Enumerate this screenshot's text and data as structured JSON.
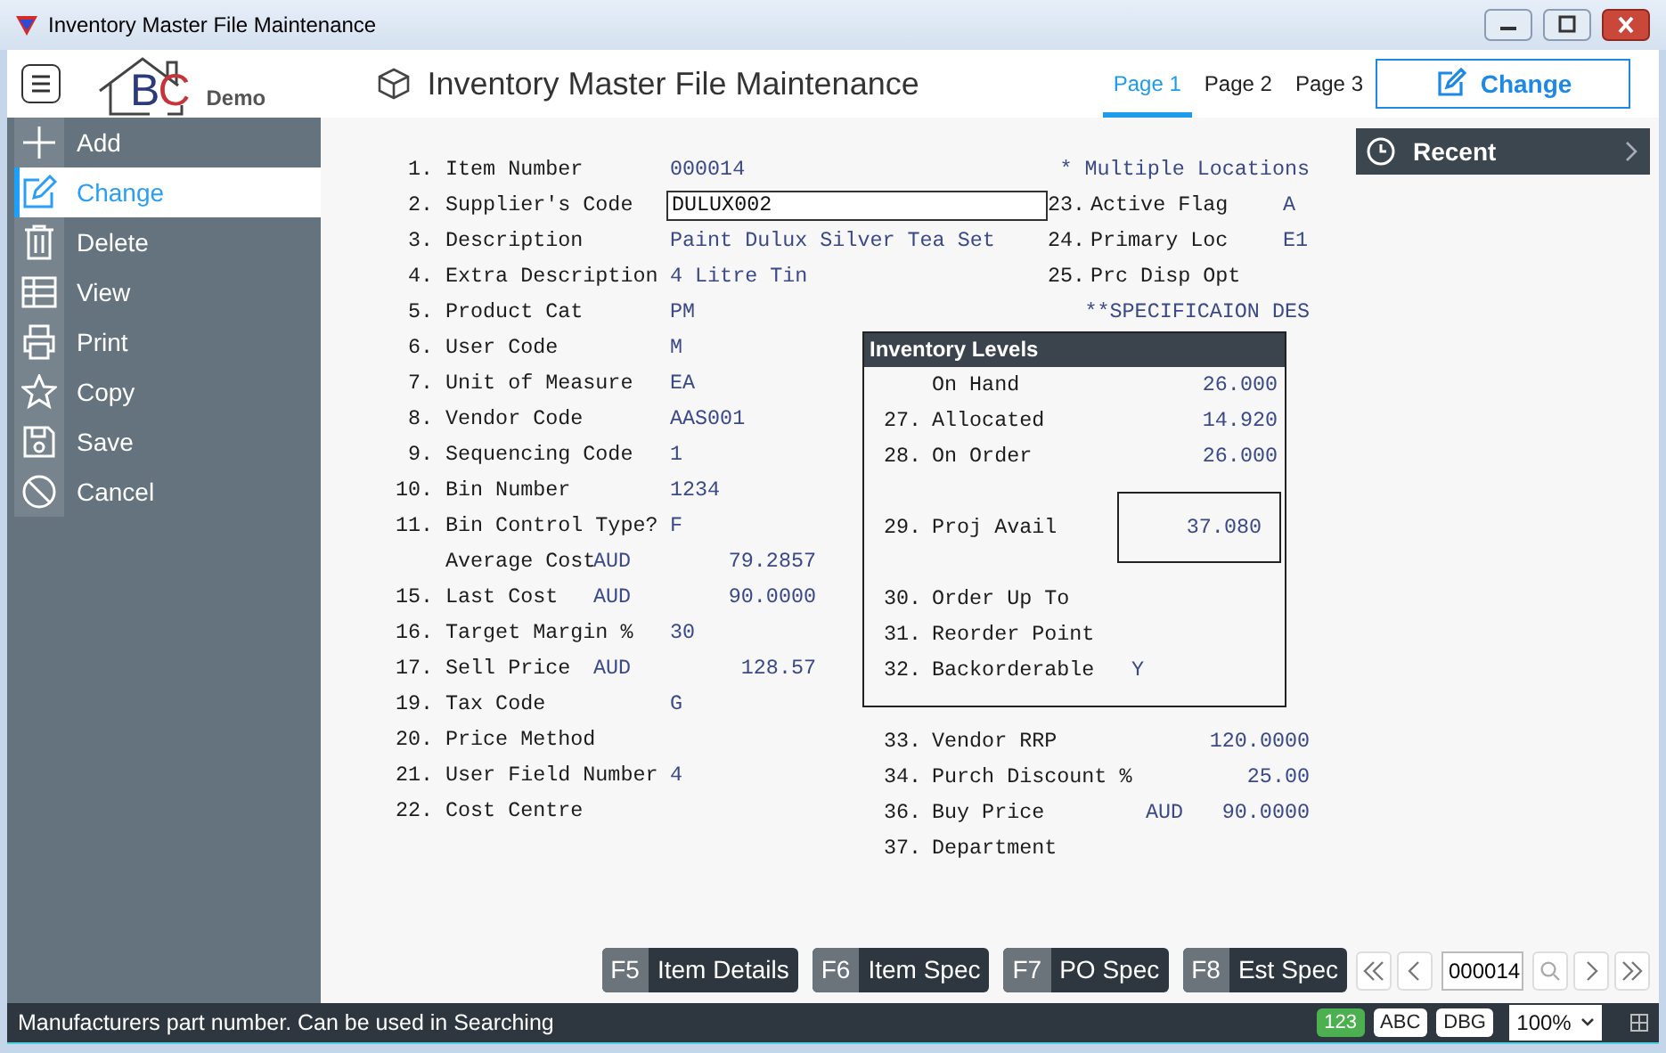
{
  "window": {
    "title": "Inventory Master File Maintenance"
  },
  "header": {
    "logo": {
      "letters": [
        "B",
        "C"
      ],
      "caption": "Demo"
    },
    "title": "Inventory Master File Maintenance",
    "tabs": [
      {
        "label": "Page 1",
        "selected": true
      },
      {
        "label": "Page 2",
        "selected": false
      },
      {
        "label": "Page 3",
        "selected": false
      }
    ],
    "action_button": "Change"
  },
  "sidebar": {
    "items": [
      {
        "label": "Add",
        "selected": false
      },
      {
        "label": "Change",
        "selected": true
      },
      {
        "label": "Delete",
        "selected": false
      },
      {
        "label": "View",
        "selected": false
      },
      {
        "label": "Print",
        "selected": false
      },
      {
        "label": "Copy",
        "selected": false
      },
      {
        "label": "Save",
        "selected": false
      },
      {
        "label": "Cancel",
        "selected": false
      }
    ]
  },
  "form": {
    "top_left": [
      {
        "kind": "text",
        "number": "1.",
        "label": "Item Number",
        "value": "000014"
      },
      {
        "kind": "input",
        "number": "2.",
        "label": "Supplier's Code",
        "value": "DULUX002"
      },
      {
        "kind": "text",
        "number": "3.",
        "label": "Description",
        "value": "Paint Dulux Silver Tea Set"
      },
      {
        "kind": "text",
        "number": "4.",
        "label": "Extra Description",
        "value": "4 Litre Tin"
      },
      {
        "kind": "text",
        "number": "5.",
        "label": "Product Cat",
        "value": "PM"
      }
    ],
    "top_right": [
      {
        "kind": "note",
        "text": "* Multiple Locations"
      },
      {
        "kind": "field",
        "number": "23.",
        "label": "Active Flag",
        "value": "A"
      },
      {
        "kind": "field",
        "number": "24.",
        "label": "Primary Loc",
        "value": "E1"
      },
      {
        "kind": "field",
        "number": "25.",
        "label": "Prc Disp Opt"
      },
      {
        "kind": "note",
        "text": "**SPECIFICAION DES"
      }
    ],
    "left": [
      {
        "number": "6.",
        "label": "User Code",
        "value": "M"
      },
      {
        "number": "7.",
        "label": "Unit of Measure",
        "value": "EA"
      },
      {
        "number": "8.",
        "label": "Vendor Code",
        "value": "AAS001"
      },
      {
        "number": "9.",
        "label": "Sequencing Code",
        "value": "1"
      },
      {
        "number": "10.",
        "label": "Bin Number",
        "value": "1234"
      },
      {
        "number": "11.",
        "label": "Bin Control Type?",
        "value": "F"
      },
      {
        "label": "Average Cost",
        "currency": "AUD",
        "value": "79.2857"
      },
      {
        "number": "15.",
        "label": "Last Cost",
        "currency": "AUD",
        "value": "90.0000"
      },
      {
        "number": "16.",
        "label": "Target Margin %",
        "value": "30"
      },
      {
        "number": "17.",
        "label": "Sell Price",
        "currency": "AUD",
        "value": "128.57"
      },
      {
        "number": "19.",
        "label": "Tax Code",
        "value": "G"
      },
      {
        "number": "20.",
        "label": "Price Method"
      },
      {
        "number": "21.",
        "label": "User Field Number",
        "value": "4"
      },
      {
        "number": "22.",
        "label": "Cost Centre"
      }
    ],
    "levels": {
      "title": "Inventory Levels",
      "rows": [
        {
          "kind": "amount",
          "label": "On Hand",
          "value": "26.000"
        },
        {
          "kind": "amount",
          "number": "27.",
          "label": "Allocated",
          "value": "14.920"
        },
        {
          "kind": "amount",
          "number": "28.",
          "label": "On Order",
          "value": "26.000"
        },
        {
          "kind": "framed",
          "number": "29.",
          "label": "Proj Avail",
          "value": "37.080"
        },
        {
          "kind": "amount",
          "number": "30.",
          "label": "Order Up To"
        },
        {
          "kind": "amount",
          "number": "31.",
          "label": "Reorder Point"
        },
        {
          "kind": "flag",
          "number": "32.",
          "label": "Backorderable",
          "value": "Y"
        }
      ]
    },
    "right": [
      {
        "number": "33.",
        "label": "Vendor RRP",
        "value": "120.0000"
      },
      {
        "number": "34.",
        "label": "Purch Discount %",
        "value": "25.00"
      },
      {
        "number": "36.",
        "label": "Buy Price",
        "currency": "AUD",
        "value": "90.0000"
      },
      {
        "number": "37.",
        "label": "Department"
      }
    ]
  },
  "recent": {
    "label": "Recent"
  },
  "function_keys": [
    {
      "key": "F5",
      "label": "Item Details"
    },
    {
      "key": "F6",
      "label": "Item Spec"
    },
    {
      "key": "F7",
      "label": "PO Spec"
    },
    {
      "key": "F8",
      "label": "Est Spec"
    }
  ],
  "navigator": {
    "value": "000014"
  },
  "status_bar": {
    "message": "Manufacturers part number. Can be used in Searching",
    "badges": [
      {
        "label": "123",
        "on": true
      },
      {
        "label": "ABC",
        "on": false
      },
      {
        "label": "DBG",
        "on": false
      }
    ],
    "zoom": "100%"
  }
}
